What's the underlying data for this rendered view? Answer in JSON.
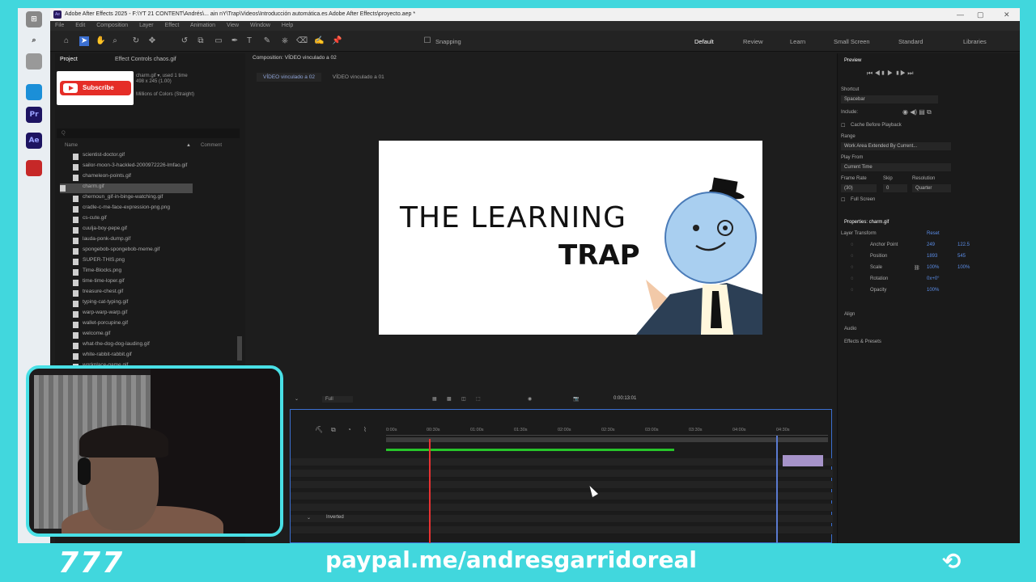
{
  "window": {
    "title": "Adobe After Effects 2025 - F:\\YT 21 CONTENT\\Andrés\\... ain nY\\Trap\\Videos\\Introducción automática.es Adobe After Effects\\proyecto.aep *",
    "menus": [
      "File",
      "Edit",
      "Composition",
      "Layer",
      "Effect",
      "Animation",
      "View",
      "Window",
      "Help"
    ]
  },
  "toolbar": {
    "snapping_label": "Snapping",
    "workspaces": [
      "Default",
      "Review",
      "Learn",
      "Small Screen",
      "Standard",
      "Libraries"
    ]
  },
  "project": {
    "tabs": [
      "Project",
      "Effect Controls chaos.gif"
    ],
    "thumb_badge": "Subscribe",
    "meta": [
      "charm.gif ▾, used 1 time",
      "498 x 245 (1.00)",
      "Millions of Colors (Straight)"
    ],
    "search_placeholder": "Q",
    "column_name": "Name",
    "column_comment": "Comment",
    "files": [
      "scientist-doctor.gif",
      "sailor-moon-3-hackled-2000972226-lmfao.gif",
      "chameleon-points.gif",
      "charm.gif",
      "chernoun_gif-in-binge-watching.gif",
      "cradle-c-me-face-expression-png.png",
      "cs-cute.gif",
      "cuulja-boy-pepe.gif",
      "lauda-ponk-dump.gif",
      "spongebob-spongebob-meme.gif",
      "SUPER-THIS.png",
      "Time-Blocks.png",
      "time-time-loper.gif",
      "treasure-chest.gif",
      "typing-cat-typing.gif",
      "warp-warp-warp.gif",
      "wallet-porcupine.gif",
      "welcome.gif",
      "what-the-dog-dog-lauding.gif",
      "white-rabbit-rabbit.gif",
      "workplace-game.gif"
    ]
  },
  "composition": {
    "panel_tab": "Composition: VÍDEO vinculado a 02",
    "breadcrumb": [
      "VÍDEO vinculado a 02",
      "VÍDEO vinculado a 01"
    ],
    "title_line1": "THE LEARNING",
    "title_line2": "TRAP",
    "zoom": "Full",
    "timecode": "0:00:13:01"
  },
  "timeline": {
    "ticks": [
      "0:00s",
      "00:30s",
      "01:00s",
      "01:30s",
      "02:00s",
      "02:30s",
      "03:00s",
      "03:30s",
      "04:00s",
      "04:30s"
    ],
    "layer_label": "Inverted"
  },
  "preview": {
    "title": "Preview",
    "shortcut_label": "Shortcut",
    "shortcut_value": "Spacebar",
    "include_label": "Include:",
    "cache_label": "Cache Before Playback",
    "range_label": "Range",
    "range_value": "Work Area Extended By Current...",
    "play_from_label": "Play From",
    "play_from_value": "Current Time",
    "frame_rate_label": "Frame Rate",
    "frame_rate_value": "(30)",
    "skip_label": "Skip",
    "skip_value": "0",
    "resolution_label": "Resolution",
    "resolution_value": "Quarter",
    "fullscreen_label": "Full Screen"
  },
  "properties": {
    "title": "Properties: charm.gif",
    "transform_label": "Layer Transform",
    "reset_label": "Reset",
    "rows": [
      {
        "label": "Anchor Point",
        "v1": "249",
        "v2": "122.5"
      },
      {
        "label": "Position",
        "v1": "1893",
        "v2": "545"
      },
      {
        "label": "Scale",
        "v1": "100%",
        "v2": "100%"
      },
      {
        "label": "Rotation",
        "v1": "0x+0°",
        "v2": ""
      },
      {
        "label": "Opacity",
        "v1": "100%",
        "v2": ""
      }
    ],
    "sections": [
      "Align",
      "Audio",
      "Effects & Presets"
    ]
  },
  "footer": {
    "left": "777",
    "url": "paypal.me/andresgarridoreal"
  }
}
